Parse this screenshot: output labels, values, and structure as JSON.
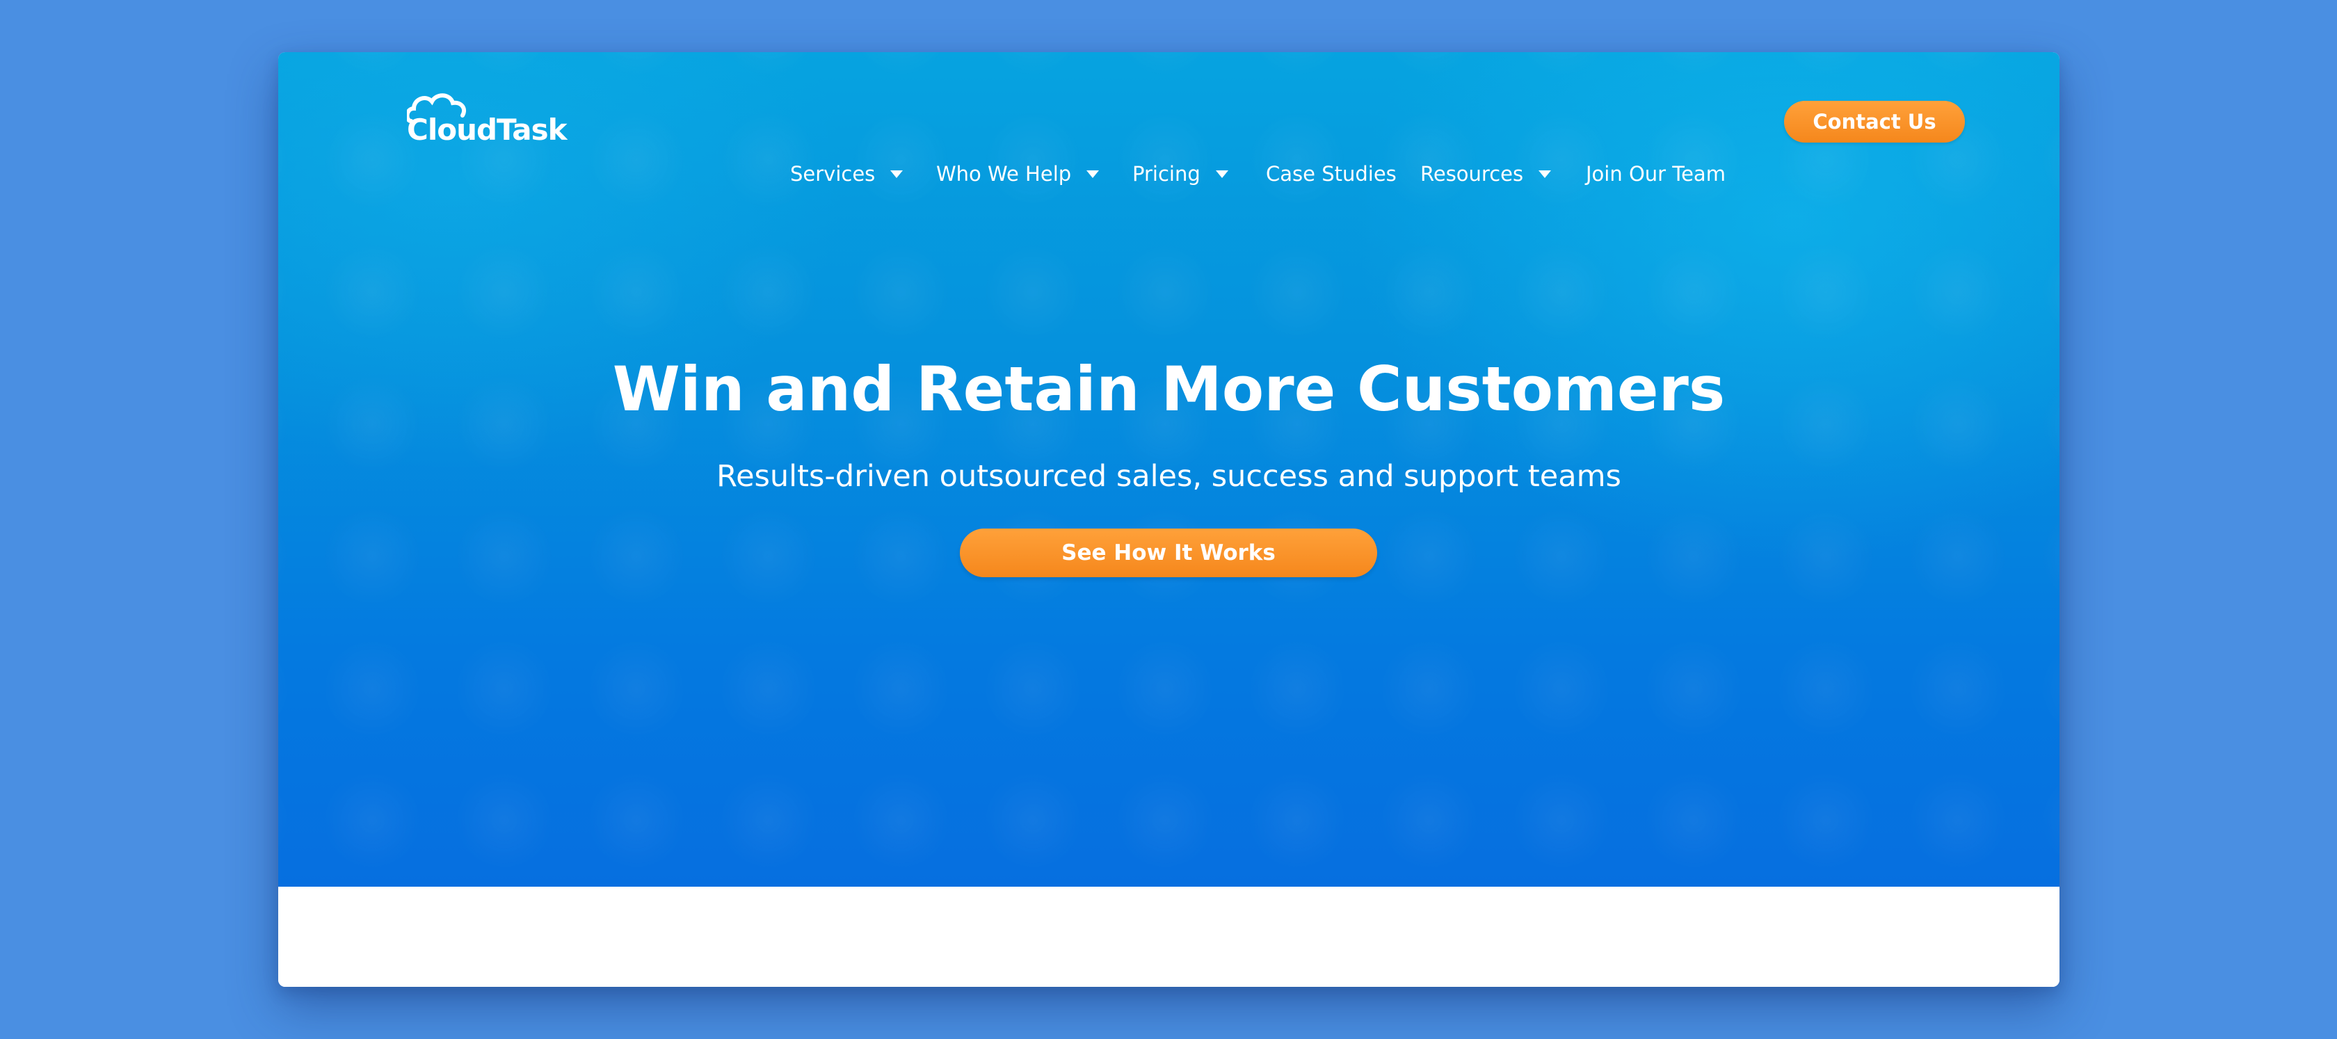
{
  "brand": {
    "logo_text": "CloudTask"
  },
  "nav": {
    "items": [
      {
        "label": "Services",
        "has_dropdown": true
      },
      {
        "label": "Who We Help",
        "has_dropdown": true
      },
      {
        "label": "Pricing",
        "has_dropdown": true
      },
      {
        "label": "Case Studies",
        "has_dropdown": false
      },
      {
        "label": "Resources",
        "has_dropdown": true
      },
      {
        "label": "Join Our Team",
        "has_dropdown": false
      }
    ],
    "contact_label": "Contact Us"
  },
  "hero": {
    "title": "Win and Retain More Customers",
    "subtitle": "Results-driven outsourced sales, success and support teams",
    "cta_label": "See How It Works"
  },
  "colors": {
    "page_background": "#4a8fe2",
    "hero_top": "#06a3e0",
    "hero_bottom": "#066fe0",
    "accent_orange": "#f5871c",
    "text_on_hero": "#ffffff"
  }
}
